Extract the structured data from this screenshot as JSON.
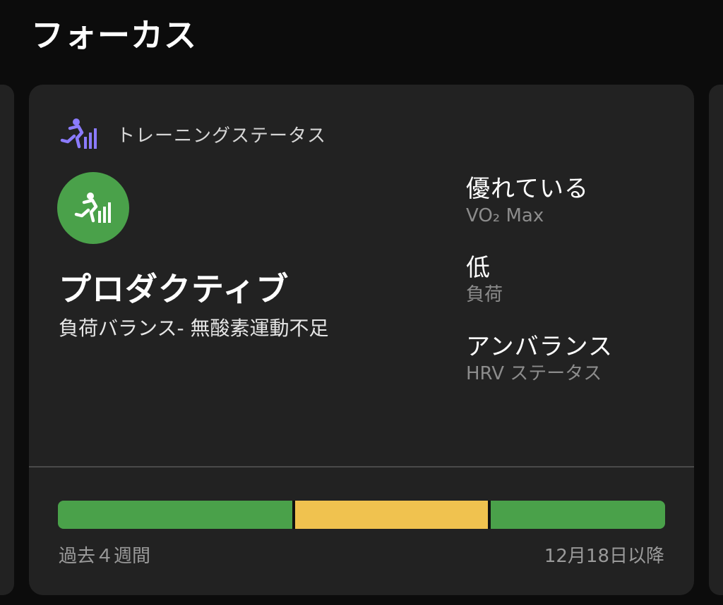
{
  "header": {
    "title": "フォーカス"
  },
  "card": {
    "header_label": "トレーニングステータス",
    "header_icon": "training-status-icon",
    "accent_color": "#8b7bff",
    "status": {
      "title": "プロダクティブ",
      "subtitle": "負荷バランス- 無酸素運動不足",
      "color": "#4aa14a",
      "icon": "training-status-icon"
    },
    "metrics": [
      {
        "value": "優れている",
        "label": "VO₂ Max"
      },
      {
        "value": "低",
        "label": "負荷"
      },
      {
        "value": "アンバランス",
        "label": "HRV ステータス"
      }
    ],
    "history": {
      "left_label": "過去４週間",
      "right_label": "12月18日以降",
      "segments": [
        {
          "color": "#4aa14a",
          "share": 0.39
        },
        {
          "color": "#f0c24f",
          "share": 0.32
        },
        {
          "color": "#4aa14a",
          "share": 0.29
        }
      ]
    }
  }
}
